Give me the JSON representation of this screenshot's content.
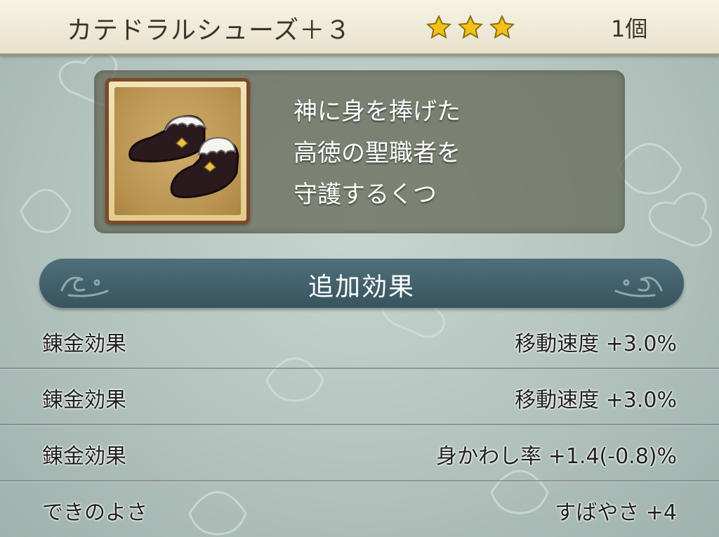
{
  "header": {
    "item_name": "カテドラルシューズ＋３",
    "stars": 3,
    "count": "1個"
  },
  "item": {
    "icon": "shoes-icon",
    "description": [
      "神に身を捧げた",
      "高徳の聖職者を",
      "守護するくつ"
    ]
  },
  "section": {
    "title": "追加効果"
  },
  "effects": [
    {
      "label": "錬金効果",
      "value": "移動速度  +3.0%"
    },
    {
      "label": "錬金効果",
      "value": "移動速度  +3.0%"
    },
    {
      "label": "錬金効果",
      "value": "身かわし率  +1.4(-0.8)%"
    },
    {
      "label": "できのよさ",
      "value": "すばやさ  +4"
    }
  ],
  "colors": {
    "header_bg": "#efeada",
    "section_bar": "#44606b",
    "icon_frame": "#7a4a2a",
    "star": "#f2c21a"
  }
}
